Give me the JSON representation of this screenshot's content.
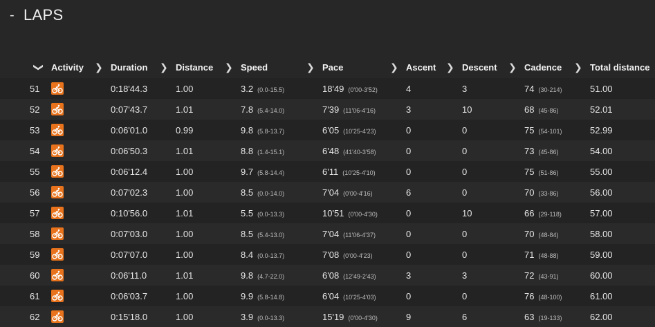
{
  "section": {
    "toggle": "-",
    "title": "LAPS"
  },
  "headers": {
    "activity": "Activity",
    "duration": "Duration",
    "distance": "Distance",
    "speed": "Speed",
    "pace": "Pace",
    "ascent": "Ascent",
    "descent": "Descent",
    "cadence": "Cadence",
    "total_distance": "Total distance",
    "sort_arrow": "❯",
    "expand_arrow": "❯"
  },
  "colors": {
    "activity_icon": "#e8731c",
    "background": "#272727"
  },
  "activity_icon_name": "cycling-icon",
  "laps": [
    {
      "lap": "51",
      "duration": "0:18'44.3",
      "distance": "1.00",
      "speed": "3.2",
      "speed_range": "(0.0-15.5)",
      "pace": "18'49",
      "pace_range": "(0'00-3'52)",
      "ascent": "4",
      "descent": "3",
      "cadence": "74",
      "cadence_range": "(30-214)",
      "total_distance": "51.00"
    },
    {
      "lap": "52",
      "duration": "0:07'43.7",
      "distance": "1.01",
      "speed": "7.8",
      "speed_range": "(5.4-14.0)",
      "pace": "7'39",
      "pace_range": "(11'06-4'16)",
      "ascent": "3",
      "descent": "10",
      "cadence": "68",
      "cadence_range": "(45-86)",
      "total_distance": "52.01"
    },
    {
      "lap": "53",
      "duration": "0:06'01.0",
      "distance": "0.99",
      "speed": "9.8",
      "speed_range": "(5.8-13.7)",
      "pace": "6'05",
      "pace_range": "(10'25-4'23)",
      "ascent": "0",
      "descent": "0",
      "cadence": "75",
      "cadence_range": "(54-101)",
      "total_distance": "52.99"
    },
    {
      "lap": "54",
      "duration": "0:06'50.3",
      "distance": "1.01",
      "speed": "8.8",
      "speed_range": "(1.4-15.1)",
      "pace": "6'48",
      "pace_range": "(41'40-3'58)",
      "ascent": "0",
      "descent": "0",
      "cadence": "73",
      "cadence_range": "(45-86)",
      "total_distance": "54.00"
    },
    {
      "lap": "55",
      "duration": "0:06'12.4",
      "distance": "1.00",
      "speed": "9.7",
      "speed_range": "(5.8-14.4)",
      "pace": "6'11",
      "pace_range": "(10'25-4'10)",
      "ascent": "0",
      "descent": "0",
      "cadence": "75",
      "cadence_range": "(51-86)",
      "total_distance": "55.00"
    },
    {
      "lap": "56",
      "duration": "0:07'02.3",
      "distance": "1.00",
      "speed": "8.5",
      "speed_range": "(0.0-14.0)",
      "pace": "7'04",
      "pace_range": "(0'00-4'16)",
      "ascent": "6",
      "descent": "0",
      "cadence": "70",
      "cadence_range": "(33-86)",
      "total_distance": "56.00"
    },
    {
      "lap": "57",
      "duration": "0:10'56.0",
      "distance": "1.01",
      "speed": "5.5",
      "speed_range": "(0.0-13.3)",
      "pace": "10'51",
      "pace_range": "(0'00-4'30)",
      "ascent": "0",
      "descent": "10",
      "cadence": "66",
      "cadence_range": "(29-118)",
      "total_distance": "57.00"
    },
    {
      "lap": "58",
      "duration": "0:07'03.0",
      "distance": "1.00",
      "speed": "8.5",
      "speed_range": "(5.4-13.0)",
      "pace": "7'04",
      "pace_range": "(11'06-4'37)",
      "ascent": "0",
      "descent": "0",
      "cadence": "70",
      "cadence_range": "(48-84)",
      "total_distance": "58.00"
    },
    {
      "lap": "59",
      "duration": "0:07'07.0",
      "distance": "1.00",
      "speed": "8.4",
      "speed_range": "(0.0-13.7)",
      "pace": "7'08",
      "pace_range": "(0'00-4'23)",
      "ascent": "0",
      "descent": "0",
      "cadence": "71",
      "cadence_range": "(48-88)",
      "total_distance": "59.00"
    },
    {
      "lap": "60",
      "duration": "0:06'11.0",
      "distance": "1.01",
      "speed": "9.8",
      "speed_range": "(4.7-22.0)",
      "pace": "6'08",
      "pace_range": "(12'49-2'43)",
      "ascent": "3",
      "descent": "3",
      "cadence": "72",
      "cadence_range": "(43-91)",
      "total_distance": "60.00"
    },
    {
      "lap": "61",
      "duration": "0:06'03.7",
      "distance": "1.00",
      "speed": "9.9",
      "speed_range": "(5.8-14.8)",
      "pace": "6'04",
      "pace_range": "(10'25-4'03)",
      "ascent": "0",
      "descent": "0",
      "cadence": "76",
      "cadence_range": "(48-100)",
      "total_distance": "61.00"
    },
    {
      "lap": "62",
      "duration": "0:15'18.0",
      "distance": "1.00",
      "speed": "3.9",
      "speed_range": "(0.0-13.3)",
      "pace": "15'19",
      "pace_range": "(0'00-4'30)",
      "ascent": "9",
      "descent": "6",
      "cadence": "63",
      "cadence_range": "(19-133)",
      "total_distance": "62.00"
    }
  ]
}
